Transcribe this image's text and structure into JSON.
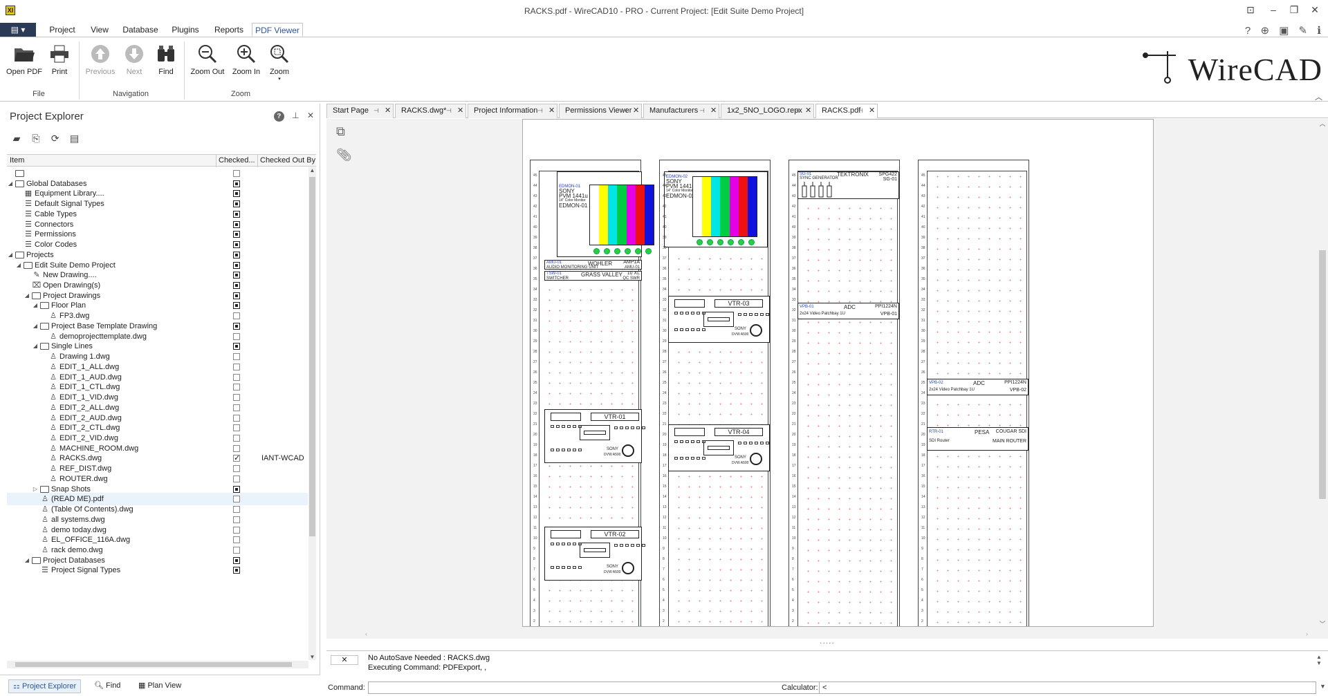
{
  "window": {
    "title": "RACKS.pdf - WireCAD10 - PRO - Current Project: [Edit Suite Demo Project]",
    "app_icon_text": "XI"
  },
  "menu": {
    "file_label": "▤ ▾",
    "tabs": [
      "Project",
      "View",
      "Database",
      "Plugins",
      "Reports",
      "PDF Viewer"
    ],
    "active_tab": "PDF Viewer"
  },
  "ribbon": {
    "file_group": {
      "label": "File",
      "buttons": [
        "Open PDF",
        "Print"
      ]
    },
    "nav_group": {
      "label": "Navigation",
      "buttons": [
        "Previous",
        "Next",
        "Find"
      ]
    },
    "zoom_group": {
      "label": "Zoom",
      "buttons": [
        "Zoom Out",
        "Zoom In",
        "Zoom"
      ]
    },
    "logo_text": "WireCAD"
  },
  "explorer": {
    "title": "Project Explorer",
    "columns": [
      "Item",
      "Checked...",
      "Checked Out By"
    ],
    "rows": [
      {
        "label": "",
        "indent": 0,
        "type": "folder",
        "exp": "",
        "check": "empty"
      },
      {
        "label": "Global Databases",
        "indent": 0,
        "type": "folder",
        "exp": "◢",
        "check": "filled"
      },
      {
        "label": "Equipment Library....",
        "indent": 1,
        "type": "db",
        "exp": "",
        "check": "filled"
      },
      {
        "label": "Default Signal Types",
        "indent": 1,
        "type": "list",
        "exp": "",
        "check": "filled"
      },
      {
        "label": "Cable Types",
        "indent": 1,
        "type": "list",
        "exp": "",
        "check": "filled"
      },
      {
        "label": "Connectors",
        "indent": 1,
        "type": "list",
        "exp": "",
        "check": "filled"
      },
      {
        "label": "Permissions",
        "indent": 1,
        "type": "list",
        "exp": "",
        "check": "filled"
      },
      {
        "label": "Color Codes",
        "indent": 1,
        "type": "list",
        "exp": "",
        "check": "filled"
      },
      {
        "label": "Projects",
        "indent": 0,
        "type": "folder",
        "exp": "◢",
        "check": "filled"
      },
      {
        "label": "Edit Suite Demo Project",
        "indent": 1,
        "type": "folder",
        "exp": "◢",
        "check": "filled"
      },
      {
        "label": "New Drawing....",
        "indent": 2,
        "type": "new",
        "exp": "",
        "check": "filled"
      },
      {
        "label": "Open Drawing(s)",
        "indent": 2,
        "type": "open",
        "exp": "",
        "check": "filled"
      },
      {
        "label": "Project Drawings",
        "indent": 2,
        "type": "folder",
        "exp": "◢",
        "check": "filled"
      },
      {
        "label": "Floor Plan",
        "indent": 3,
        "type": "folder",
        "exp": "◢",
        "check": "filled"
      },
      {
        "label": "FP3.dwg",
        "indent": 4,
        "type": "dwg",
        "exp": "",
        "check": "empty"
      },
      {
        "label": "Project Base Template Drawing",
        "indent": 3,
        "type": "folder",
        "exp": "◢",
        "check": "filled"
      },
      {
        "label": "demoprojecttemplate.dwg",
        "indent": 4,
        "type": "dwg",
        "exp": "",
        "check": "empty"
      },
      {
        "label": "Single Lines",
        "indent": 3,
        "type": "folder",
        "exp": "◢",
        "check": "filled"
      },
      {
        "label": "Drawing 1.dwg",
        "indent": 4,
        "type": "dwg",
        "exp": "",
        "check": "empty"
      },
      {
        "label": "EDIT_1_ALL.dwg",
        "indent": 4,
        "type": "dwg",
        "exp": "",
        "check": "empty"
      },
      {
        "label": "EDIT_1_AUD.dwg",
        "indent": 4,
        "type": "dwg",
        "exp": "",
        "check": "empty"
      },
      {
        "label": "EDIT_1_CTL.dwg",
        "indent": 4,
        "type": "dwg",
        "exp": "",
        "check": "empty"
      },
      {
        "label": "EDIT_1_VID.dwg",
        "indent": 4,
        "type": "dwg",
        "exp": "",
        "check": "empty"
      },
      {
        "label": "EDIT_2_ALL.dwg",
        "indent": 4,
        "type": "dwg",
        "exp": "",
        "check": "empty"
      },
      {
        "label": "EDIT_2_AUD.dwg",
        "indent": 4,
        "type": "dwg",
        "exp": "",
        "check": "empty"
      },
      {
        "label": "EDIT_2_CTL.dwg",
        "indent": 4,
        "type": "dwg",
        "exp": "",
        "check": "empty"
      },
      {
        "label": "EDIT_2_VID.dwg",
        "indent": 4,
        "type": "dwg",
        "exp": "",
        "check": "empty"
      },
      {
        "label": "MACHINE_ROOM.dwg",
        "indent": 4,
        "type": "dwg",
        "exp": "",
        "check": "empty"
      },
      {
        "label": "RACKS.dwg",
        "indent": 4,
        "type": "dwg-lock",
        "exp": "",
        "check": "checked",
        "checked_out_by": "IANT-WCAD"
      },
      {
        "label": "REF_DIST.dwg",
        "indent": 4,
        "type": "dwg",
        "exp": "",
        "check": "empty"
      },
      {
        "label": "ROUTER.dwg",
        "indent": 4,
        "type": "dwg",
        "exp": "",
        "check": "empty"
      },
      {
        "label": "Snap Shots",
        "indent": 3,
        "type": "folder",
        "exp": "▷",
        "check": "filled"
      },
      {
        "label": "(READ ME).pdf",
        "indent": 3,
        "type": "dwg",
        "exp": "",
        "check": "empty",
        "selected": true
      },
      {
        "label": "(Table Of Contents).dwg",
        "indent": 3,
        "type": "dwg",
        "exp": "",
        "check": "empty"
      },
      {
        "label": "all systems.dwg",
        "indent": 3,
        "type": "dwg",
        "exp": "",
        "check": "empty"
      },
      {
        "label": "demo today.dwg",
        "indent": 3,
        "type": "dwg",
        "exp": "",
        "check": "empty"
      },
      {
        "label": "EL_OFFICE_116A.dwg",
        "indent": 3,
        "type": "dwg",
        "exp": "",
        "check": "empty"
      },
      {
        "label": "rack demo.dwg",
        "indent": 3,
        "type": "dwg",
        "exp": "",
        "check": "empty"
      },
      {
        "label": "Project Databases",
        "indent": 2,
        "type": "folder",
        "exp": "◢",
        "check": "filled"
      },
      {
        "label": "Project Signal Types",
        "indent": 3,
        "type": "list",
        "exp": "",
        "check": "filled"
      }
    ],
    "bottom_tabs": [
      "Project Explorer",
      "Find",
      "Plan View"
    ]
  },
  "doc_tabs": [
    {
      "label": "Start Page"
    },
    {
      "label": "RACKS.dwg*"
    },
    {
      "label": "Project Information"
    },
    {
      "label": "Permissions Viewer"
    },
    {
      "label": "Manufacturers"
    },
    {
      "label": "1x2_5NO_LOGO.repx"
    },
    {
      "label": "RACKS.pdf",
      "active": true
    }
  ],
  "drawing": {
    "monitor1": {
      "id": "EDMON-01",
      "l1": "SONY",
      "l2": "PVM 1441u",
      "l3": "14\" Color Monitor",
      "l4": "EDMON-01"
    },
    "monitor2": {
      "id": "EDMON-02",
      "l1": "SONY",
      "l2": "PVM 1441u",
      "l3": "14\" Color Monitor",
      "l4": "EDMON-02"
    },
    "amp": {
      "id": "AMU-01",
      "mfr": "WOHLER",
      "model": "AMP1A",
      "desc": "AUDIO MONITORING UNIT",
      "tag": "AMU-01"
    },
    "switcher": {
      "id": "TSW-01",
      "mfr": "GRASS VALLEY",
      "model": "10 XL",
      "desc": "SWITCHER",
      "tag": "QC SWR"
    },
    "syncgen": {
      "id": "SG-01",
      "mfr": "TEKTRONIX",
      "model": "SPG422",
      "desc": "SYNC GENERATOR",
      "tag": "SG-01"
    },
    "patch1": {
      "id": "VPB-01",
      "mfr": "ADC",
      "model": "PPI1224N",
      "desc": "2x24 Video Patchbay 1U",
      "tag": "VPB-01"
    },
    "patch2": {
      "id": "VPB-02",
      "mfr": "ADC",
      "model": "PPI1224N",
      "desc": "2x24 Video Patchbay 1U",
      "tag": "VPB-02"
    },
    "router": {
      "id": "RTR-01",
      "mfr": "PESA",
      "model": "COUGAR SDI",
      "desc": "SDI Router",
      "tag": "MAIN ROUTER"
    },
    "vtrs": [
      "VTR-01",
      "VTR-02",
      "VTR-03",
      "VTR-04"
    ],
    "vtr_brand": "SONY",
    "vtr_model": "DVW A500"
  },
  "status": {
    "lines": [
      "No AutoSave Needed : RACKS.dwg",
      "Executing Command: PDFExport, ,"
    ],
    "command_label": "Command:",
    "calculator_label": "Calculator:",
    "calculator_value": "<"
  },
  "colors": {
    "accent": "#2b5797",
    "bars": [
      "#ffffff",
      "#ffff00",
      "#00e5e5",
      "#00cc44",
      "#e600e6",
      "#ee1111",
      "#1111dd"
    ]
  }
}
